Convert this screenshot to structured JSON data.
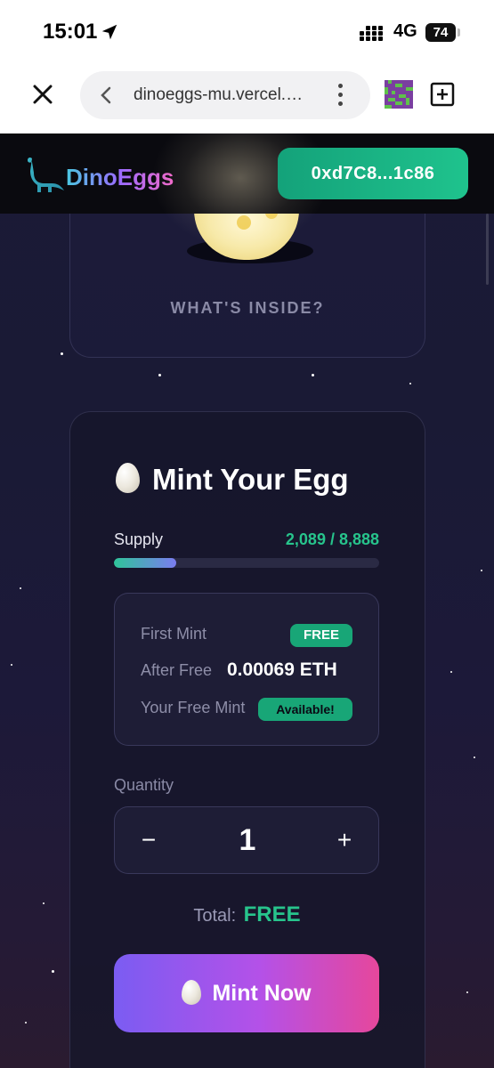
{
  "status_bar": {
    "time": "15:01",
    "network": "4G",
    "battery": "74"
  },
  "browser": {
    "url": "dinoeggs-mu.vercel.…",
    "icons": [
      "close-icon",
      "back-icon",
      "more-icon",
      "extension-icon",
      "new-tab-icon"
    ]
  },
  "header": {
    "brand": "DinoEggs",
    "wallet_address": "0xd7C8...1c86"
  },
  "reveal_card": {
    "label": "WHAT'S INSIDE?"
  },
  "mint_card": {
    "title": "Mint Your Egg",
    "supply_label": "Supply",
    "supply_value": "2,089 / 8,888",
    "supply_fraction": 0.235,
    "pricing": {
      "first_mint_label": "First Mint",
      "first_mint_value": "FREE",
      "after_free_label": "After Free",
      "after_free_value": "0.00069 ETH",
      "free_mint_label": "Your Free Mint",
      "free_mint_value": "Available!"
    },
    "quantity_label": "Quantity",
    "quantity_minus": "−",
    "quantity_value": "1",
    "quantity_plus": "+",
    "total_label": "Total:",
    "total_value": "FREE",
    "mint_button_label": "Mint Now"
  },
  "colors": {
    "accent_green": "#27c48c",
    "wallet_button": "#16a37a",
    "mint_gradient_start": "#7b5cf2",
    "mint_gradient_end": "#e6479c",
    "background": "#1b1a36"
  }
}
